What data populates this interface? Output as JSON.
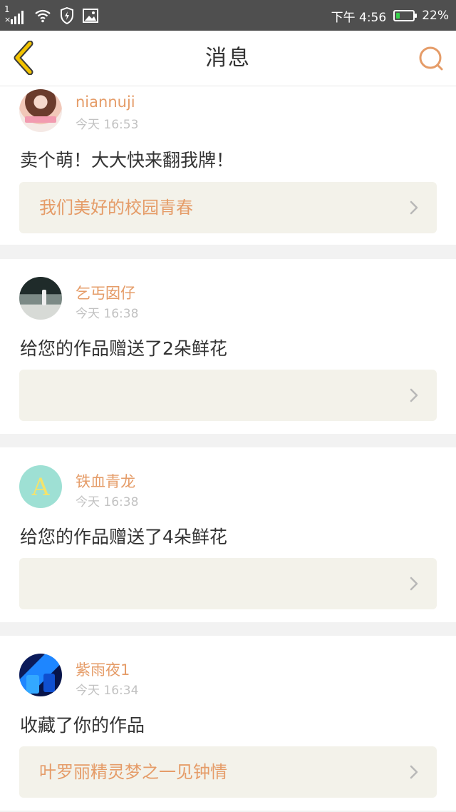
{
  "status_bar": {
    "sim_slot": "1",
    "time": "下午 4:56",
    "battery": "22%",
    "battery_level": 0.22,
    "icons": [
      "signal-icon",
      "wifi-icon",
      "shield-icon",
      "image-icon"
    ]
  },
  "header": {
    "title": "消息"
  },
  "messages": [
    {
      "name": "niannuji",
      "time": "今天 16:53",
      "text": "卖个萌！大大快来翻我牌！",
      "link": "我们美好的校园青春"
    },
    {
      "name": "乞丐囡仔",
      "time": "今天 16:38",
      "text": "给您的作品赠送了2朵鲜花",
      "link": ""
    },
    {
      "name": "铁血青龙",
      "time": "今天 16:38",
      "text": "给您的作品赠送了4朵鲜花",
      "link": ""
    },
    {
      "name": "紫雨夜1",
      "time": "今天 16:34",
      "text": "收藏了你的作品",
      "link": "叶罗丽精灵梦之一见钟情"
    }
  ],
  "colors": {
    "accent": "#e59c68",
    "back_icon": "#f2c300",
    "link_bg": "#f3f2ea",
    "status_bar": "#4f4f4f"
  }
}
